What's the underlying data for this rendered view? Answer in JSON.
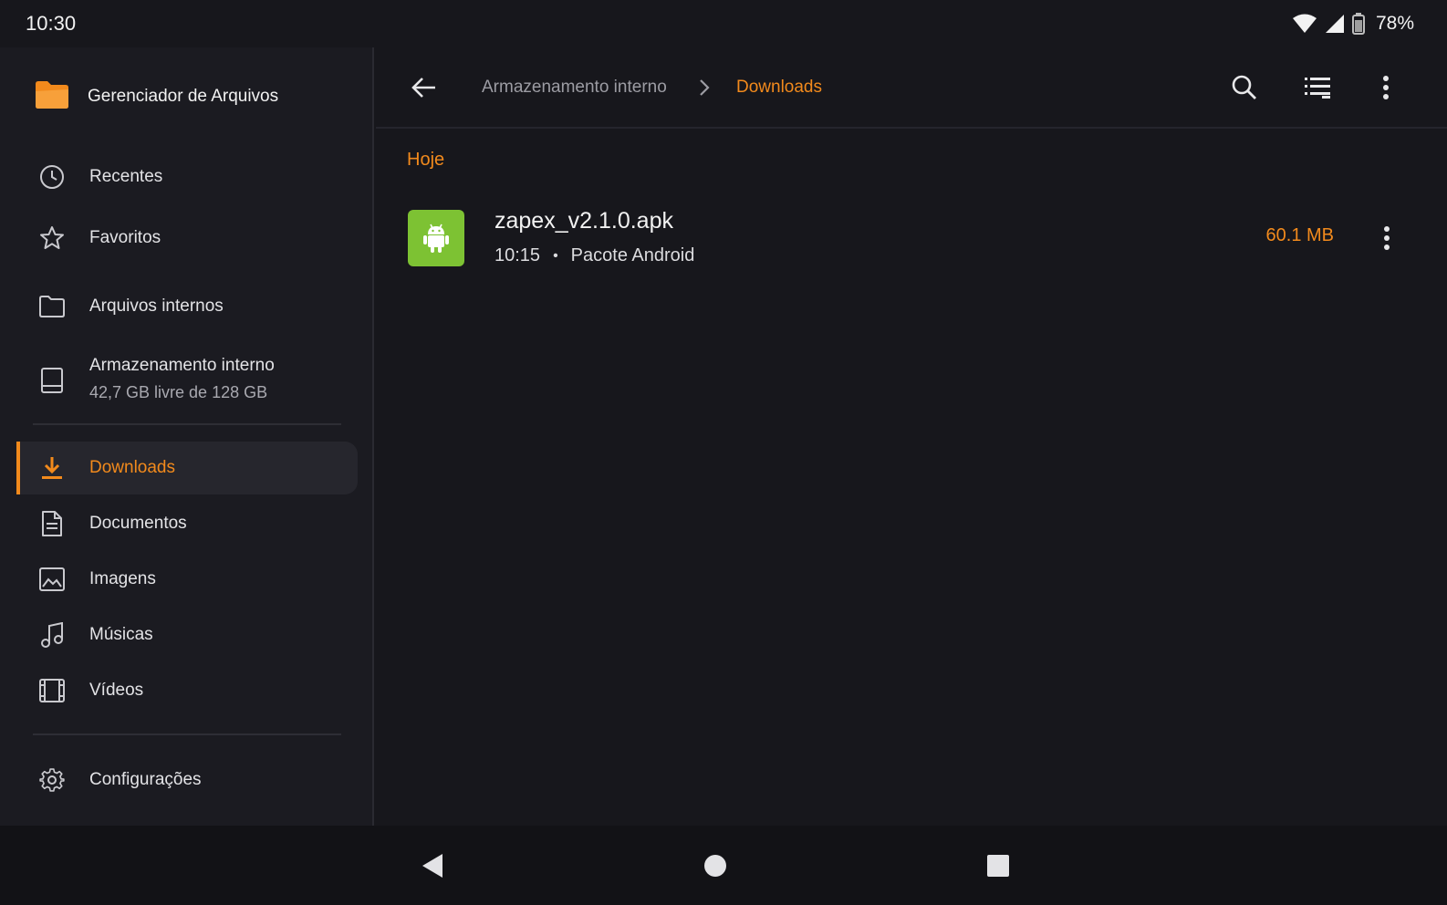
{
  "status_bar": {
    "time": "10:30",
    "battery_percent": "78%",
    "icons": [
      "wifi-icon",
      "signal-icon",
      "battery-icon"
    ]
  },
  "app": {
    "title": "Gerenciador de Arquivos",
    "icon": "folder-icon",
    "accent_color": "#f28a1c"
  },
  "sidebar": {
    "items": [
      {
        "label": "Recentes",
        "icon": "clock-icon"
      },
      {
        "label": "Favoritos",
        "icon": "star-icon"
      },
      {
        "label": "Arquivos internos",
        "icon": "folder-outline-icon"
      }
    ],
    "storage": {
      "title": "Armazenamento interno",
      "subtitle": "42,7 GB livre de 128 GB",
      "icon": "storage-icon"
    },
    "categories": [
      {
        "label": "Downloads",
        "icon": "download-icon",
        "active": true
      },
      {
        "label": "Documentos",
        "icon": "document-icon"
      },
      {
        "label": "Imagens",
        "icon": "image-icon"
      },
      {
        "label": "Músicas",
        "icon": "music-icon"
      },
      {
        "label": "Vídeos",
        "icon": "video-icon"
      }
    ],
    "settings": {
      "label": "Configurações",
      "icon": "gear-icon"
    }
  },
  "toolbar": {
    "breadcrumb_parent": "Armazenamento interno",
    "breadcrumb_current": "Downloads",
    "icons": [
      "back-arrow-icon",
      "chevron-right-icon",
      "search-icon",
      "list-view-icon",
      "more-vert-icon"
    ]
  },
  "content": {
    "section_title": "Hoje",
    "files": [
      {
        "name": "zapex_v2.1.0.apk",
        "time": "10:15",
        "separator": "•",
        "type": "Pacote Android",
        "size": "60.1 MB",
        "icon": "android-icon",
        "thumb_color": "#7dc233"
      }
    ]
  },
  "navigation_bar": {
    "icons": [
      "nav-back-icon",
      "nav-home-icon",
      "nav-recents-icon"
    ]
  }
}
